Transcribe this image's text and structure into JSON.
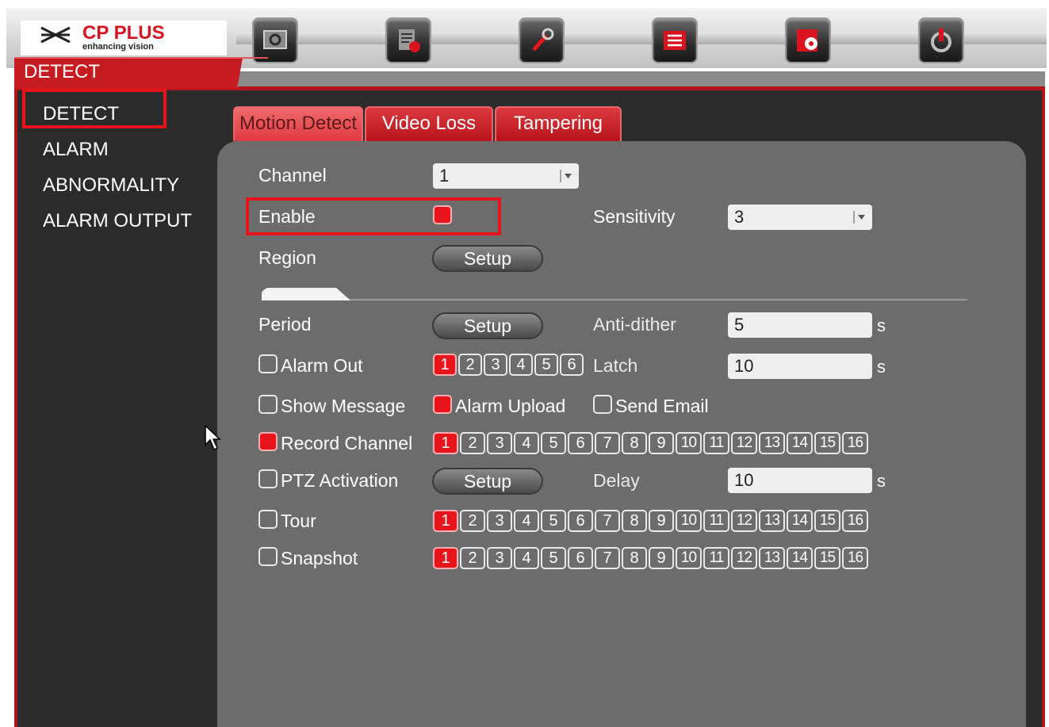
{
  "brand": {
    "name": "CP PLUS",
    "tagline": "enhancing vision"
  },
  "toolbar": {
    "icons": [
      "search-icon",
      "settings-icon",
      "wrench-icon",
      "list-icon",
      "backup-icon",
      "power-icon"
    ]
  },
  "page_title": "DETECT",
  "sidebar": {
    "items": [
      {
        "label": "DETECT"
      },
      {
        "label": "ALARM"
      },
      {
        "label": "ABNORMALITY"
      },
      {
        "label": "ALARM OUTPUT"
      }
    ]
  },
  "tabs": [
    {
      "label": "Motion Detect",
      "active": true
    },
    {
      "label": "Video Loss"
    },
    {
      "label": "Tampering"
    }
  ],
  "form": {
    "channel": {
      "label": "Channel",
      "value": "1"
    },
    "enable": {
      "label": "Enable",
      "checked": true
    },
    "sensitivity": {
      "label": "Sensitivity",
      "value": "3"
    },
    "region": {
      "label": "Region",
      "button": "Setup"
    },
    "period": {
      "label": "Period",
      "button": "Setup"
    },
    "anti_dither": {
      "label": "Anti-dither",
      "value": "5",
      "unit": "s"
    },
    "alarm_out": {
      "label": "Alarm Out",
      "checked": false,
      "outputs": [
        "1",
        "2",
        "3",
        "4",
        "5",
        "6"
      ],
      "selected": [
        "1"
      ]
    },
    "latch": {
      "label": "Latch",
      "value": "10",
      "unit": "s"
    },
    "show_message": {
      "label": "Show Message",
      "checked": false
    },
    "alarm_upload": {
      "label": "Alarm Upload",
      "checked": true
    },
    "send_email": {
      "label": "Send Email",
      "checked": false
    },
    "record_channel": {
      "label": "Record Channel",
      "checked": true,
      "selected": [
        "1"
      ]
    },
    "ptz_activation": {
      "label": "PTZ Activation",
      "checked": false,
      "button": "Setup"
    },
    "delay": {
      "label": "Delay",
      "value": "10",
      "unit": "s"
    },
    "tour": {
      "label": "Tour",
      "checked": false,
      "selected": [
        "1"
      ]
    },
    "snapshot": {
      "label": "Snapshot",
      "checked": false,
      "selected": [
        "1"
      ]
    },
    "channels": [
      "1",
      "2",
      "3",
      "4",
      "5",
      "6",
      "7",
      "8",
      "9",
      "10",
      "11",
      "12",
      "13",
      "14",
      "15",
      "16"
    ]
  },
  "colors": {
    "accent": "#e8141c",
    "panel": "#6c6c6c",
    "background": "#2b2b2b"
  }
}
